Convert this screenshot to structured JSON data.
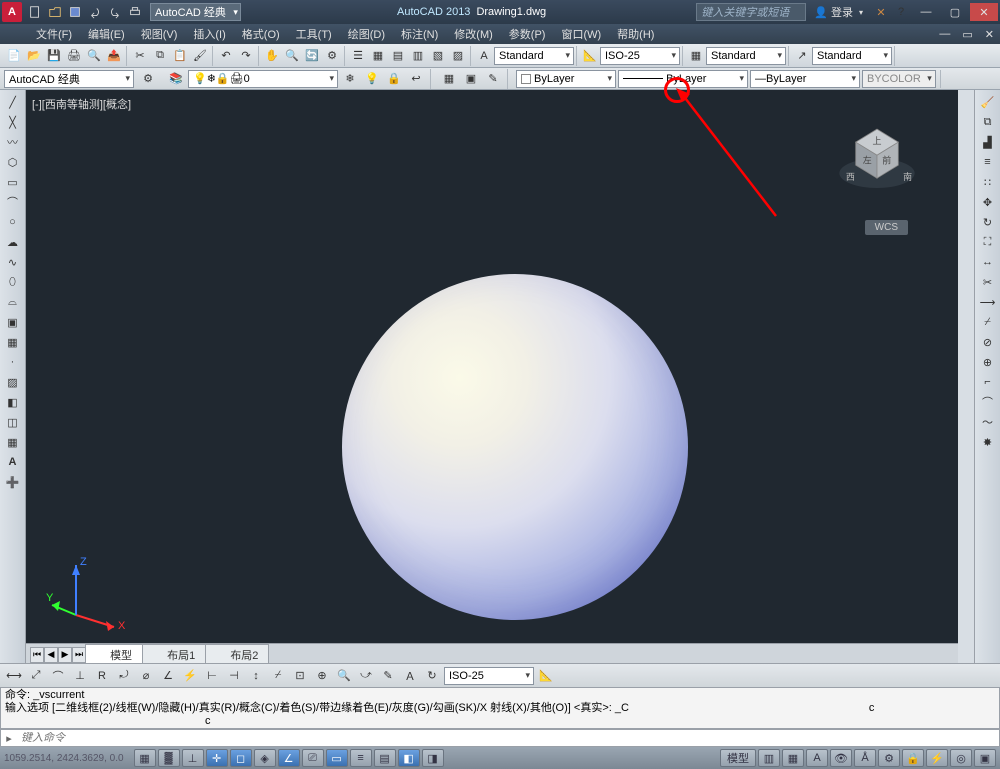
{
  "app": {
    "name": "AutoCAD 2013",
    "document": "Drawing1.dwg",
    "search_placeholder": "键入关键字或短语",
    "login": "登录"
  },
  "workspace": {
    "current": "AutoCAD 经典",
    "qat_workspace": "AutoCAD 经典"
  },
  "menu": {
    "file": "文件(F)",
    "edit": "编辑(E)",
    "view": "视图(V)",
    "insert": "插入(I)",
    "format": "格式(O)",
    "tools": "工具(T)",
    "draw": "绘图(D)",
    "dimension": "标注(N)",
    "modify": "修改(M)",
    "param": "参数(P)",
    "window": "窗口(W)",
    "help": "帮助(H)"
  },
  "styles": {
    "text": "Standard",
    "dim": "ISO-25",
    "table": "Standard",
    "mleader": "Standard"
  },
  "layer": {
    "current": "0",
    "color": "ByLayer",
    "linetype": "ByLayer",
    "lineweight": "ByLayer",
    "plotstyle": "BYCOLOR"
  },
  "visual": {
    "style": "西南等轴测"
  },
  "viewport": {
    "label": "[-][西南等轴测][概念]",
    "wcs": "WCS"
  },
  "tabs": {
    "model": "模型",
    "layout1": "布局1",
    "layout2": "布局2"
  },
  "dimbar": {
    "style": "ISO-25"
  },
  "command": {
    "line1": "命令:  _vscurrent",
    "line2": "输入选项 [二维线框(2)/线框(W)/隐藏(H)/真实(R)/概念(C)/着色(S)/带边缘着色(E)/灰度(G)/勾画(SK)/X 射线(X)/其他(O)] <真实>:  _C",
    "prompt_icon": "▸",
    "placeholder": "键入命令"
  },
  "status": {
    "coords": "1059.2514, 2424.3629, 0.0",
    "model_btn": "模型"
  },
  "viewcube": {
    "top": "上",
    "left": "左",
    "front": "前",
    "west": "西",
    "south": "南"
  }
}
